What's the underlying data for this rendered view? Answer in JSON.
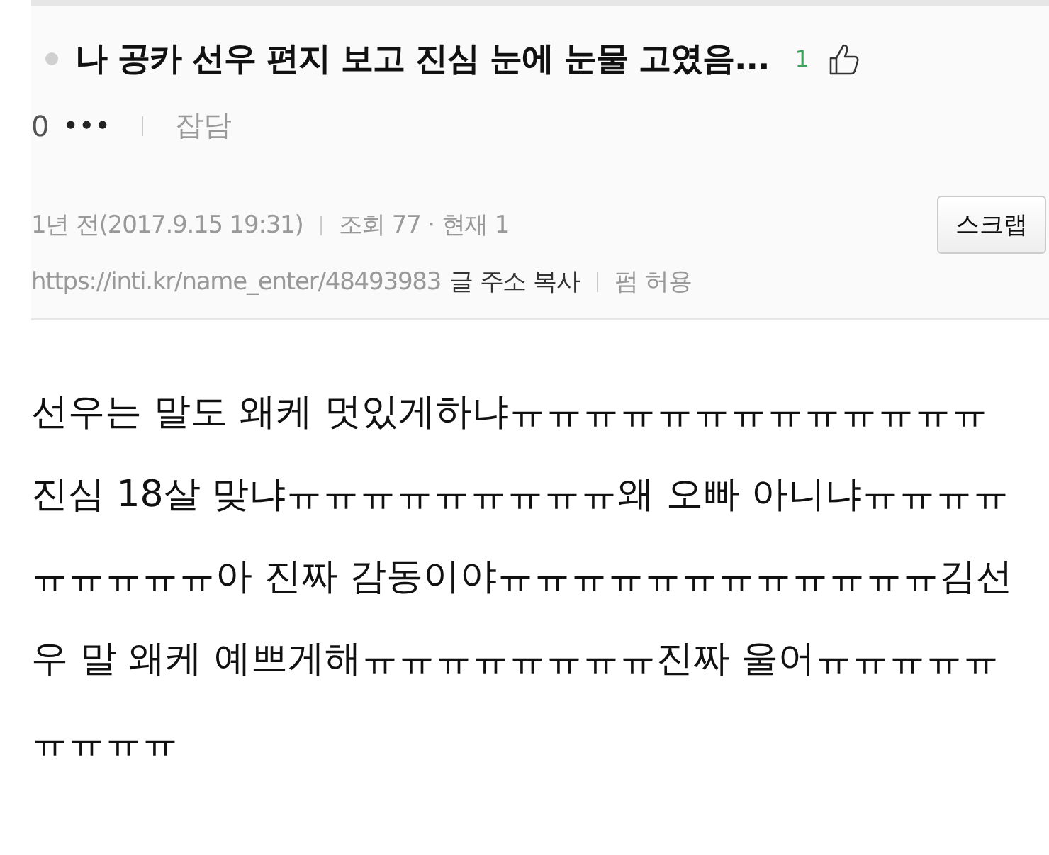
{
  "post": {
    "title": "나 공카 선우 편지 보고 진심 눈에 눈물 고였음...",
    "likes": "1",
    "comments": "0",
    "more": "•••",
    "category": "잡담",
    "date": "1년 전(2017.9.15 19:31)",
    "views": "조회 77 · 현재 1",
    "scrap_button": "스크랩",
    "url": "https://inti.kr/name_enter/48493983",
    "copy_link": "글 주소 복사",
    "repost": "펌 허용"
  },
  "body": "선우는 말도 왜케 멋있게하냐ㅠㅠㅠㅠㅠㅠㅠㅠㅠㅠㅠㅠㅠ진심 18살 맞냐ㅠㅠㅠㅠㅠㅠㅠㅠㅠ왜 오빠 아니냐ㅠㅠㅠㅠㅠㅠㅠㅠㅠ아 진짜 감동이야ㅠㅠㅠㅠㅠㅠㅠㅠㅠㅠㅠㅠ김선우 말 왜케 예쁘게해ㅠㅠㅠㅠㅠㅠㅠㅠ진짜 울어ㅠㅠㅠㅠㅠㅠㅠㅠㅠ"
}
